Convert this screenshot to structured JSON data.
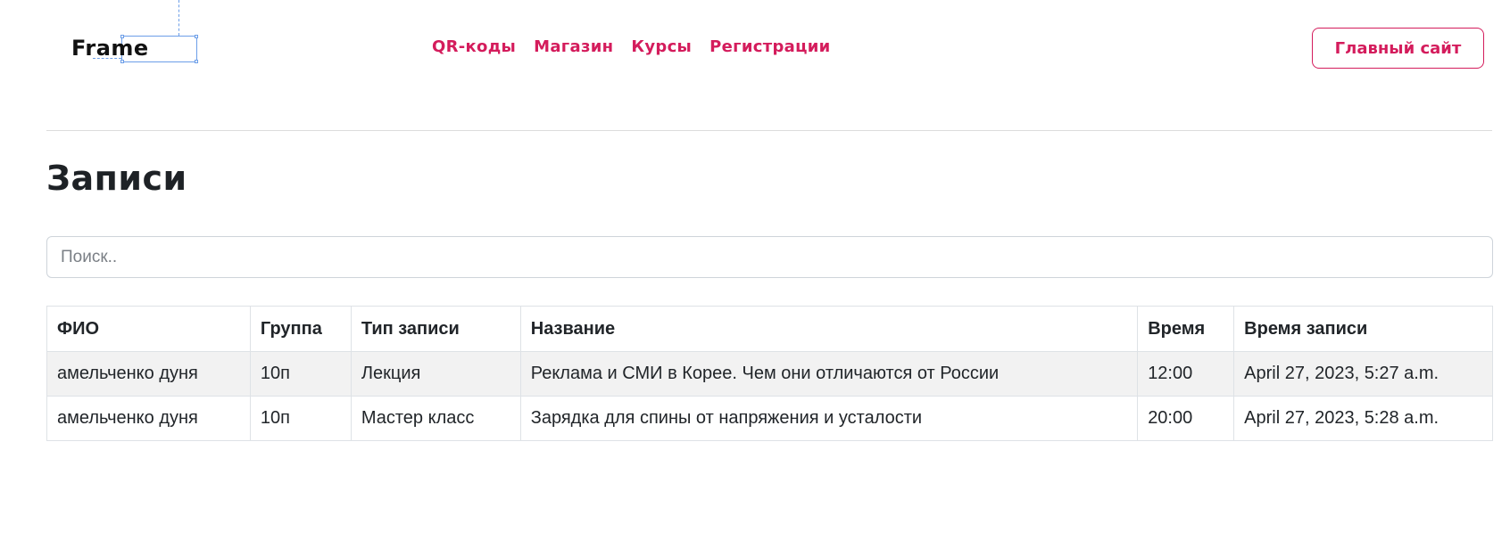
{
  "header": {
    "logo_text": "Frame",
    "nav": [
      {
        "label": "QR-коды"
      },
      {
        "label": "Магазин"
      },
      {
        "label": "Курсы"
      },
      {
        "label": "Регистрации"
      }
    ],
    "main_site_label": "Главный сайт",
    "accent_color": "#d41c5c"
  },
  "page": {
    "title": "Записи"
  },
  "search": {
    "placeholder": "Поиск.."
  },
  "table": {
    "columns": [
      "ФИО",
      "Группа",
      "Тип записи",
      "Название",
      "Время",
      "Время записи"
    ],
    "rows": [
      [
        "амельченко дуня",
        "10п",
        "Лекция",
        "Реклама и СМИ в Корее. Чем они отличаются от России",
        "12:00",
        "April 27, 2023, 5:27 a.m."
      ],
      [
        "амельченко дуня",
        "10п",
        "Мастер класс",
        "Зарядка для спины от напряжения и усталости",
        "20:00",
        "April 27, 2023, 5:28 a.m."
      ]
    ]
  }
}
